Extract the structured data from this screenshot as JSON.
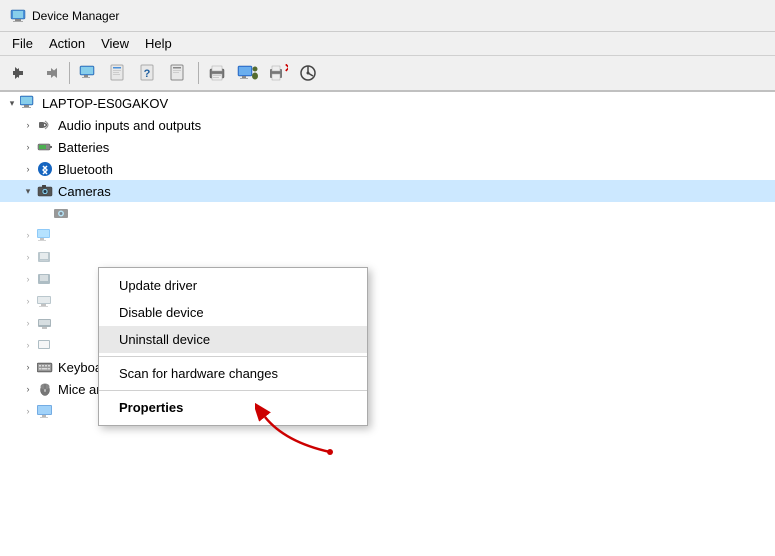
{
  "titleBar": {
    "title": "Device Manager",
    "iconSymbol": "💻"
  },
  "menuBar": {
    "items": [
      {
        "label": "File",
        "id": "file"
      },
      {
        "label": "Action",
        "id": "action"
      },
      {
        "label": "View",
        "id": "view"
      },
      {
        "label": "Help",
        "id": "help"
      }
    ]
  },
  "toolbar": {
    "buttons": [
      {
        "id": "back",
        "symbol": "←",
        "title": "Back"
      },
      {
        "id": "forward",
        "symbol": "→",
        "title": "Forward"
      },
      {
        "id": "device-manager-icon",
        "symbol": "🖥",
        "title": "Device Manager"
      },
      {
        "id": "properties2",
        "symbol": "📋",
        "title": "Properties"
      },
      {
        "id": "help-icon",
        "symbol": "❓",
        "title": "Help"
      },
      {
        "id": "properties3",
        "symbol": "📊",
        "title": ""
      },
      {
        "id": "update-driver-tb",
        "symbol": "🖨",
        "title": "Update Driver"
      },
      {
        "id": "monitor-icon",
        "symbol": "🖥",
        "title": "Monitor"
      },
      {
        "id": "remove",
        "symbol": "✕",
        "title": "Remove",
        "color": "red"
      },
      {
        "id": "scan",
        "symbol": "⊕",
        "title": "Scan for Changes"
      }
    ]
  },
  "tree": {
    "rootItem": {
      "label": "LAPTOP-ES0GAKOV",
      "expanded": true,
      "indent": "indent1"
    },
    "items": [
      {
        "label": "Audio inputs and outputs",
        "icon": "audio",
        "indent": "indent2",
        "expand": ">"
      },
      {
        "label": "Batteries",
        "icon": "battery",
        "indent": "indent2",
        "expand": ">"
      },
      {
        "label": "Bluetooth",
        "icon": "bluetooth",
        "indent": "indent2",
        "expand": ">"
      },
      {
        "label": "Cameras",
        "icon": "camera",
        "indent": "indent2",
        "expand": "v",
        "selected": true
      },
      {
        "label": "",
        "icon": "device-small",
        "indent": "indent3",
        "expand": ""
      },
      {
        "label": "",
        "icon": "monitor",
        "indent": "indent2",
        "expand": ">"
      },
      {
        "label": "",
        "icon": "device2",
        "indent": "indent2",
        "expand": ">"
      },
      {
        "label": "",
        "icon": "device3",
        "indent": "indent2",
        "expand": ">"
      },
      {
        "label": "",
        "icon": "device4",
        "indent": "indent2",
        "expand": ">"
      },
      {
        "label": "",
        "icon": "device5",
        "indent": "indent2",
        "expand": ">"
      },
      {
        "label": "",
        "icon": "device6",
        "indent": "indent2",
        "expand": ">"
      },
      {
        "label": "Keyboards",
        "icon": "keyboard",
        "indent": "indent2",
        "expand": ">"
      },
      {
        "label": "Mice and other pointing devices",
        "icon": "mouse",
        "indent": "indent2",
        "expand": ">"
      },
      {
        "label": "",
        "icon": "monitor2",
        "indent": "indent2",
        "expand": ">"
      }
    ]
  },
  "contextMenu": {
    "items": [
      {
        "label": "Update driver",
        "id": "update-driver",
        "type": "normal"
      },
      {
        "label": "Disable device",
        "id": "disable-device",
        "type": "normal"
      },
      {
        "label": "Uninstall device",
        "id": "uninstall-device",
        "type": "highlighted"
      },
      {
        "type": "separator"
      },
      {
        "label": "Scan for hardware changes",
        "id": "scan-hardware",
        "type": "normal"
      },
      {
        "type": "separator"
      },
      {
        "label": "Properties",
        "id": "properties",
        "type": "bold"
      }
    ]
  },
  "redDot": {
    "visible": true
  }
}
